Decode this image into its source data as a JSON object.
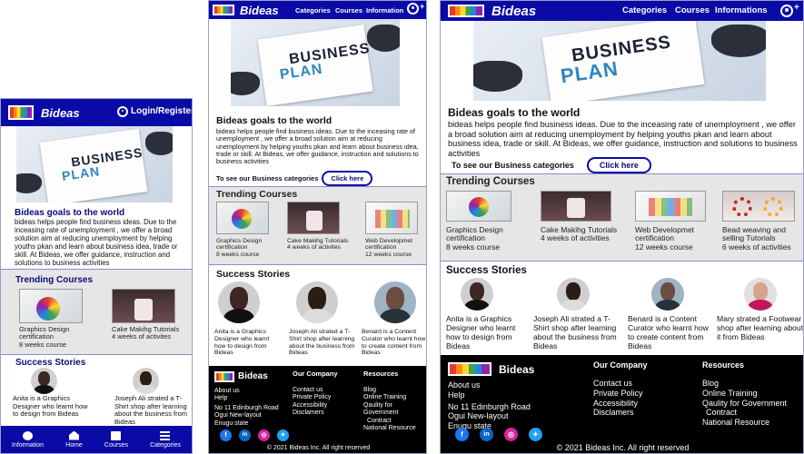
{
  "brand": {
    "name": "Bideas"
  },
  "nav": {
    "categories": "Categories",
    "courses": "Courses",
    "information": "Information",
    "informations": "Informations",
    "login": "Login/Register"
  },
  "hero": {
    "word1": "BUSINESS",
    "word2": "PLAN"
  },
  "goals": {
    "title": "Bideas goals to the world",
    "text": "bideas helps people find business ideas. Due to the inceasing rate of unemployment , we offer  a broad solution aim at reducing unemployment by helping youths pkan and learn about  business idea, trade or skill. At Bideas, we offer guidance, instruction and solutions to business activities",
    "text_wide": "bideas helps people find business ideas. Due to the inceasing rate of unemployment , we offer  a broad solution aim at reducing unemployment by helping youths pkan and learn about  business idea, trade or skill. At Bideas, we offer guidance, instruction and solutions to business activities",
    "categories_prompt": "To  see our Business categories",
    "click_here": "Click here"
  },
  "trending": {
    "title": "Trending Courses",
    "courses": [
      {
        "name": "Graphics Design certification",
        "detail": "8 weeks course"
      },
      {
        "name": "Cake Makihg Tutorials",
        "detail": "4 weeks of activites"
      },
      {
        "name": "Web Developmet certification",
        "detail": "12 weeks course"
      },
      {
        "name": "Bead weaving and selling Tutorials",
        "detail": "6 weeks of activities"
      }
    ],
    "cake_detail_wide": "4 weeks of activities"
  },
  "stories": {
    "title": "Success Stories",
    "items": [
      {
        "text": "Anita is a Graphics Designer who learnt how to design from Bideas"
      },
      {
        "text": "Joseph Ali strated a T-Shirt shop after learning about the business from Bideas"
      },
      {
        "text": "Benard is a Content Curator who learnt how to create content from Bideas"
      },
      {
        "text": "Mary strated a Footwear shop after learning about it  from Bideas"
      }
    ]
  },
  "footer": {
    "brand": "Bideas",
    "about": "About us",
    "help": "Help",
    "address1": "No 11 Edinburgh Road",
    "address2": "Ogui New-layout",
    "address3": "Enugu state",
    "company_title": "Our Company",
    "company_links": [
      "Contact us",
      "Private Policy",
      "Accessibility",
      "Disclamers"
    ],
    "resources_title": "Resources",
    "resources_links": [
      "Blog",
      "Online Training",
      "Qaulity for  Government",
      "Contract",
      "National Resource"
    ],
    "socials": [
      "facebook-icon",
      "linkedin-icon",
      "instagram-icon",
      "twitter-icon"
    ],
    "social_glyphs": [
      "f",
      "in",
      "◎",
      "✦"
    ],
    "copyright": "© 2021 Bideas Inc. All right reserved"
  },
  "bottom_nav": [
    "Information",
    "Home",
    "Courses",
    "Categories"
  ],
  "colors": {
    "nav": "#0a0aa6",
    "accent_title": "#0a0a7a",
    "footer": "#000000"
  }
}
